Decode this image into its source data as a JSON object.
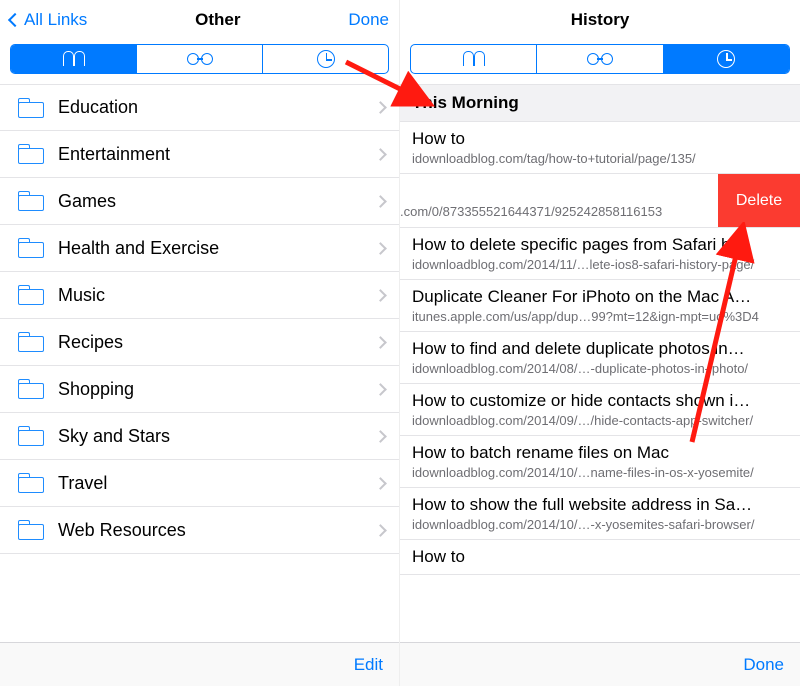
{
  "left": {
    "back_label": "All Links",
    "title": "Other",
    "done_label": "Done",
    "edit_label": "Edit",
    "segments": [
      "bookmarks",
      "readinglist",
      "history"
    ],
    "active_segment": 0,
    "folders": [
      {
        "label": "Education"
      },
      {
        "label": "Entertainment"
      },
      {
        "label": "Games"
      },
      {
        "label": "Health and Exercise"
      },
      {
        "label": "Music"
      },
      {
        "label": "Recipes"
      },
      {
        "label": "Shopping"
      },
      {
        "label": "Sky and Stars"
      },
      {
        "label": "Travel"
      },
      {
        "label": "Web Resources"
      }
    ]
  },
  "right": {
    "title": "History",
    "done_label": "Done",
    "segments": [
      "bookmarks",
      "readinglist",
      "history"
    ],
    "active_segment": 2,
    "section_header": "This Morning",
    "swipe_delete_label": "Delete",
    "items": [
      {
        "title": "How to",
        "url": "idownloadblog.com/tag/how-to+tutorial/page/135/"
      },
      {
        "title": "",
        "url": ".com/0/873355521644371/925242858116153"
      },
      {
        "title": "How to delete specific pages from Safari hi…",
        "url": "idownloadblog.com/2014/11/…lete-ios8-safari-history-page/"
      },
      {
        "title": "Duplicate Cleaner For iPhoto on the Mac A…",
        "url": "itunes.apple.com/us/app/dup…99?mt=12&ign-mpt=uo%3D4"
      },
      {
        "title": "How to find and delete duplicate photos in…",
        "url": "idownloadblog.com/2014/08/…-duplicate-photos-in-iphoto/"
      },
      {
        "title": "How to customize or hide contacts shown i…",
        "url": "idownloadblog.com/2014/09/…/hide-contacts-app-switcher/"
      },
      {
        "title": "How to batch rename files on Mac",
        "url": "idownloadblog.com/2014/10/…name-files-in-os-x-yosemite/"
      },
      {
        "title": "How to show the full website address in Sa…",
        "url": "idownloadblog.com/2014/10/…-x-yosemites-safari-browser/"
      },
      {
        "title": "How to",
        "url": ""
      }
    ]
  },
  "colors": {
    "accent": "#007aff",
    "delete": "#fb3b30"
  }
}
